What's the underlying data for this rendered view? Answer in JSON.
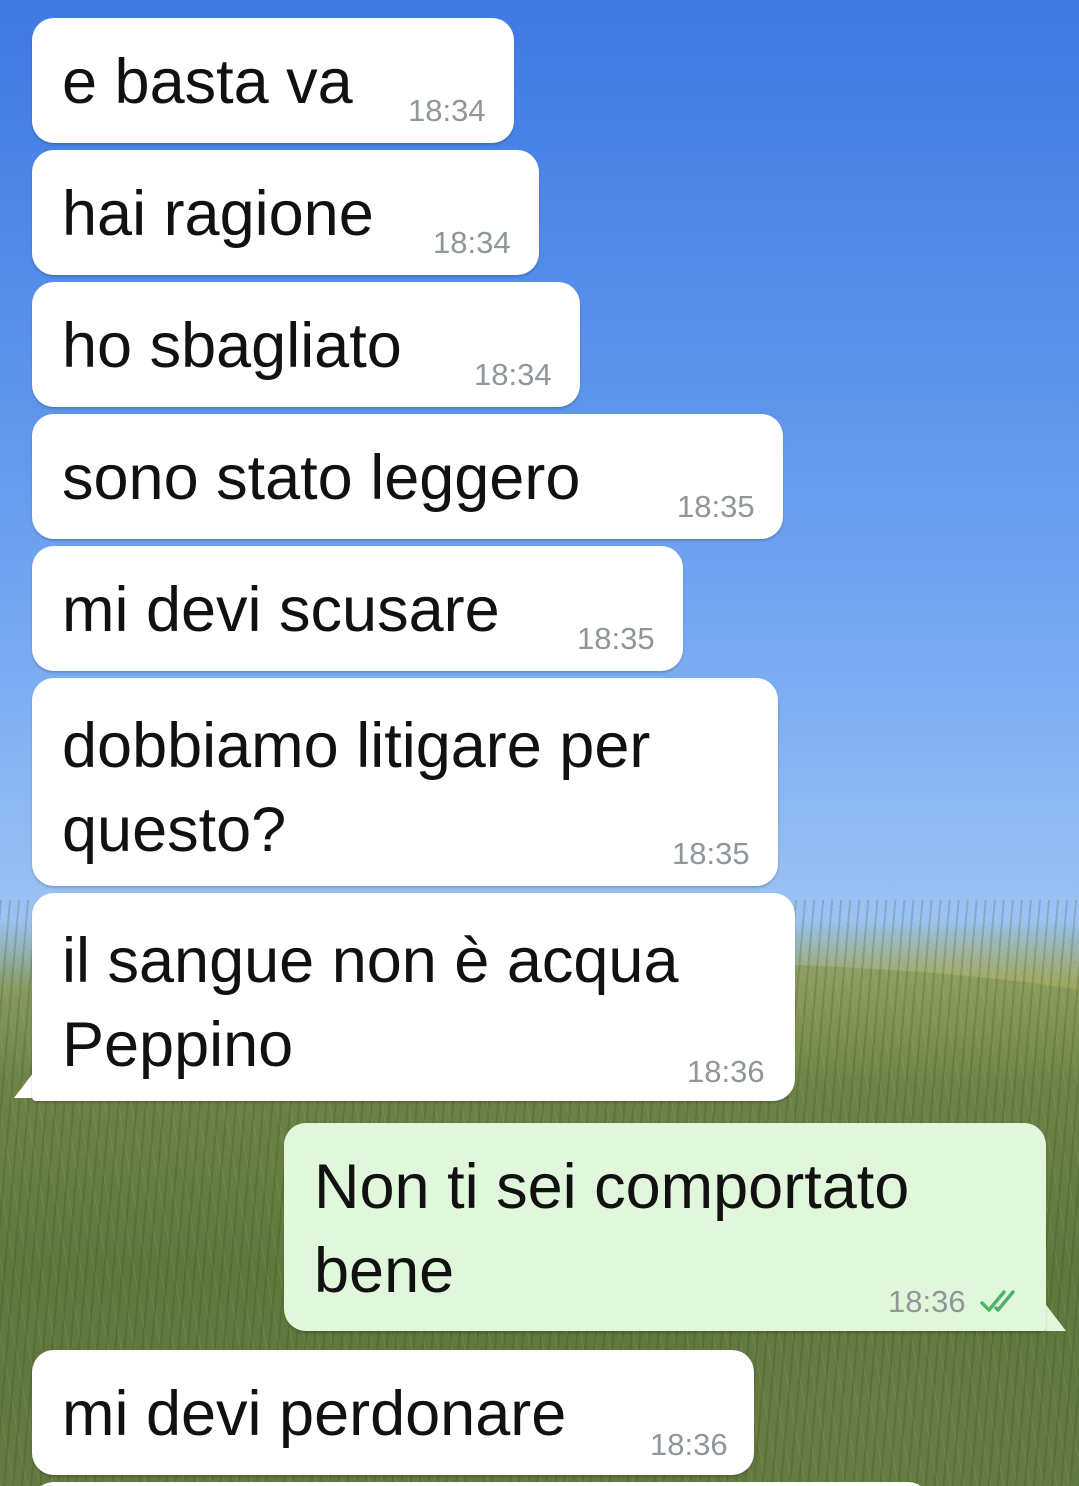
{
  "messages": [
    {
      "text": "e basta va",
      "time": "18:34",
      "direction": "incoming"
    },
    {
      "text": "hai ragione",
      "time": "18:34",
      "direction": "incoming"
    },
    {
      "text": "ho sbagliato",
      "time": "18:34",
      "direction": "incoming"
    },
    {
      "text": "sono stato leggero",
      "time": "18:35",
      "direction": "incoming"
    },
    {
      "text": "mi devi scusare",
      "time": "18:35",
      "direction": "incoming"
    },
    {
      "line1": "dobbiamo litigare per",
      "line2": "questo?",
      "time": "18:35",
      "direction": "incoming"
    },
    {
      "line1": "il sangue non è acqua",
      "line2": "Peppino",
      "time": "18:36",
      "direction": "incoming"
    },
    {
      "line1": "Non ti sei comportato",
      "line2": "bene",
      "time": "18:36",
      "direction": "outgoing",
      "status": "read",
      "status_icon": "double-check-icon"
    },
    {
      "text": "mi devi perdonare",
      "time": "18:36",
      "direction": "incoming"
    }
  ],
  "colors": {
    "incoming_bubble": "#ffffff",
    "outgoing_bubble": "#e1f7dc",
    "timestamp": "#8f979b",
    "read_ticks": "#4fb36c"
  }
}
